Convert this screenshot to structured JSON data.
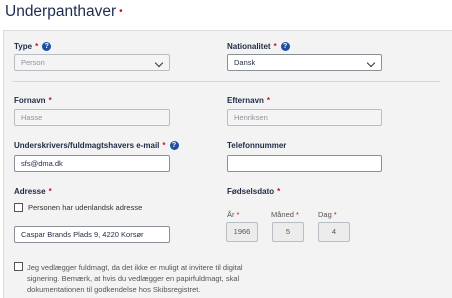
{
  "title": "Underpanthaver",
  "title_marker": "•",
  "required_marker": "*",
  "help_glyph": "?",
  "type": {
    "label": "Type",
    "value": "Person"
  },
  "nationality": {
    "label": "Nationalitet",
    "value": "Dansk"
  },
  "first_name": {
    "label": "Fornavn",
    "value": "Hasse"
  },
  "last_name": {
    "label": "Efternavn",
    "value": "Henriksen"
  },
  "email": {
    "label": "Underskrivers/fuldmagtshavers e-mail",
    "value": "sfs@dma.dk"
  },
  "phone": {
    "label": "Telefonnummer",
    "value": ""
  },
  "address": {
    "label": "Adresse",
    "foreign_checkbox_label": "Personen har udenlandsk adresse",
    "value": "Caspar Brands Plads 9, 4220 Korsør"
  },
  "birthdate": {
    "label": "Fødselsdato",
    "year_label": "År",
    "year": "1966",
    "month_label": "Måned",
    "month": "5",
    "day_label": "Dag",
    "day": "4"
  },
  "proxy_note": "Jeg vedlægger fuldmagt, da det ikke er muligt at invitere til digital signering. Bemærk, at hvis du vedlægger en papirfuldmagt, skal dokumentationen til godkendelse hos Skibsregistret.",
  "colors": {
    "required": "#c8102e",
    "help": "#1e4fa3",
    "panel": "#f3f3f3"
  }
}
